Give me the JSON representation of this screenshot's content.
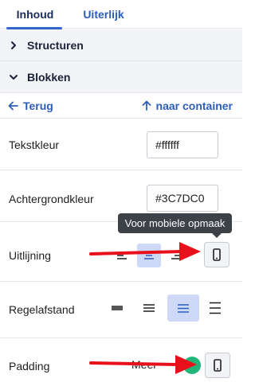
{
  "tabs": {
    "active": "Inhoud",
    "inactive": "Uiterlijk"
  },
  "sections": {
    "structuren": "Structuren",
    "blokken": "Blokken"
  },
  "nav": {
    "back": "Terug",
    "to_container": "naar container"
  },
  "properties": {
    "tekstkleur": {
      "label": "Tekstkleur",
      "value": "#ffffff"
    },
    "achtergrondkleur": {
      "label": "Achtergrondkleur",
      "value": "#3C7DC0"
    },
    "uitlijning": {
      "label": "Uitlijning",
      "selected": "center"
    },
    "regelafstand": {
      "label": "Regelafstand",
      "selected": "medium"
    },
    "padding": {
      "label": "Padding",
      "toggle_text": "Meer"
    }
  },
  "tooltip": {
    "text": "Voor mobiele opmaak"
  },
  "colors": {
    "accent": "#2d5db8",
    "selected_bg": "#cdd9f7",
    "toggle": "#22b57a",
    "annotation_arrow": "#e8101a",
    "tooltip_bg": "#3d4148"
  }
}
